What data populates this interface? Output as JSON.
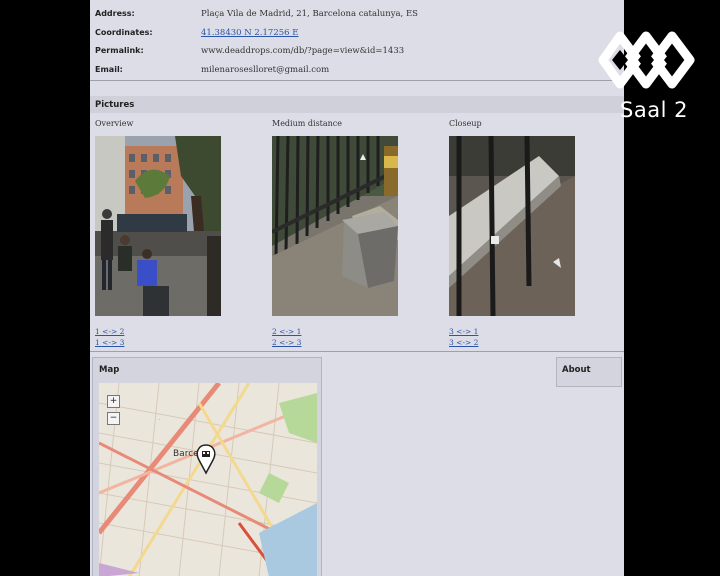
{
  "info": {
    "address_label": "Address:",
    "address_value": "Plaça Vila de Madrid, 21, Barcelona catalunya, ES",
    "coordinates_label": "Coordinates:",
    "coordinates_value": "41.38430 N 2.17256 E",
    "permalink_label": "Permalink:",
    "permalink_value": "www.deaddrops.com/db/?page=view&id=1433",
    "email_label": "Email:",
    "email_value": "milenaroseslloret@gmail.com"
  },
  "pictures": {
    "heading": "Pictures",
    "columns": [
      {
        "label": "Overview",
        "links": [
          "1 <-> 2",
          "1 <-> 3"
        ]
      },
      {
        "label": "Medium distance",
        "links": [
          "2 <-> 1",
          "2 <-> 3"
        ]
      },
      {
        "label": "Closeup",
        "links": [
          "3 <-> 1",
          "3 <-> 2"
        ]
      }
    ]
  },
  "map": {
    "heading": "Map",
    "zoom_in": "+",
    "zoom_out": "−",
    "place_label": "Barce"
  },
  "about": {
    "heading": "About"
  },
  "overlay": {
    "channel_text": "Saal 2"
  }
}
